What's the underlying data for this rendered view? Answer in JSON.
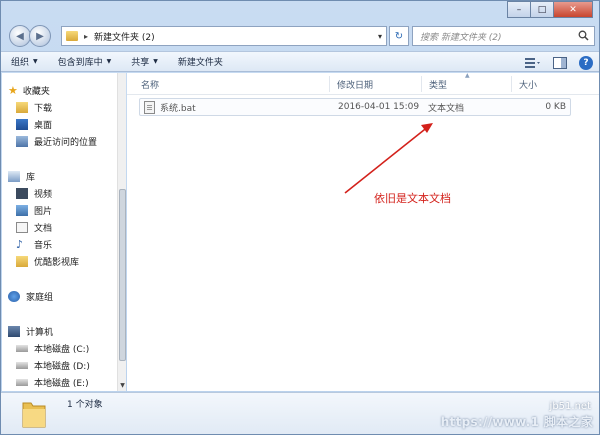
{
  "window": {
    "controls": {
      "minimize": "–",
      "maximize": "□",
      "close": "✕"
    }
  },
  "address_bar": {
    "breadcrumb_sep": "▸",
    "path": "新建文件夹 (2)",
    "dropdown": "▾",
    "refresh": "↻"
  },
  "search": {
    "placeholder": "搜索 新建文件夹 (2)",
    "icon": "search-icon"
  },
  "toolbar": {
    "organize": "组织",
    "include_in_library": "包含到库中",
    "share": "共享",
    "new_folder": "新建文件夹",
    "arrow": "▼",
    "view_icon": "view-options-icon",
    "preview_icon": "preview-pane-icon",
    "help": "?"
  },
  "nav": {
    "favorites": {
      "label": "收藏夹",
      "items": [
        "下载",
        "桌面",
        "最近访问的位置"
      ]
    },
    "libraries": {
      "label": "库",
      "items": [
        "视频",
        "图片",
        "文档",
        "音乐",
        "优酷影视库"
      ]
    },
    "homegroup": "家庭组",
    "computer": {
      "label": "计算机",
      "items": [
        "本地磁盘 (C:)",
        "本地磁盘 (D:)",
        "本地磁盘 (E:)"
      ]
    }
  },
  "columns": {
    "name": "名称",
    "date": "修改日期",
    "type": "类型",
    "size": "大小"
  },
  "files": [
    {
      "name": "系统.bat",
      "date": "2016-04-01 15:09",
      "type": "文本文档",
      "size": "0 KB"
    }
  ],
  "annotation": {
    "text": "依旧是文本文档",
    "color": "#d3211b"
  },
  "status": {
    "count": "1 个对象"
  },
  "watermark": {
    "site": "jb51.net",
    "slogan": "https://www.1 脚本之家"
  },
  "colors": {
    "accent": "#2b6cc4",
    "annotation": "#d3211b"
  }
}
